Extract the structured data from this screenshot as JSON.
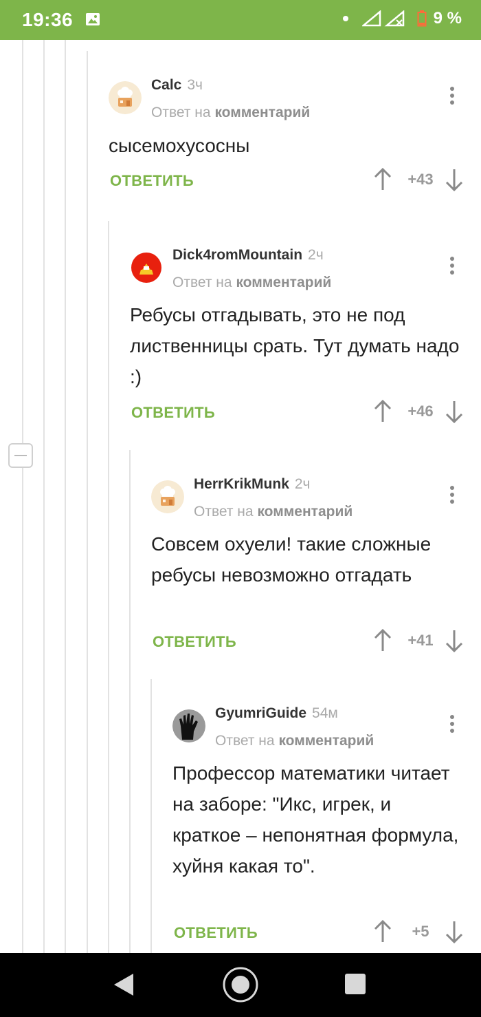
{
  "status_bar": {
    "time": "19:36",
    "battery": "9 %",
    "colors": {
      "background": "#7eb54a"
    }
  },
  "comments": [
    {
      "username": "Calc",
      "time": "3ч",
      "reply_prefix": "Ответ на",
      "reply_link": "комментарий",
      "text": "сысемохусосны",
      "reply_label": "ОТВЕТИТЬ",
      "score": "+43",
      "avatar": "chef-hat-avatar"
    },
    {
      "username": "Dick4romMountain",
      "time": "2ч",
      "reply_prefix": "Ответ на",
      "reply_link": "комментарий",
      "text": "Ребусы отгадывать, это не под лиственницы срать. Тут думать надо :)",
      "reply_label": "ОТВЕТИТЬ",
      "score": "+46",
      "avatar": "red-circle-avatar"
    },
    {
      "username": "HerrKrikMunk",
      "time": "2ч",
      "reply_prefix": "Ответ на",
      "reply_link": "комментарий",
      "text": "Совсем охуели! такие сложные ребусы невозможно отгадать",
      "reply_label": "ОТВЕТИТЬ",
      "score": "+41",
      "avatar": "chef-hat-avatar"
    },
    {
      "username": "GyumriGuide",
      "time": "54м",
      "reply_prefix": "Ответ на",
      "reply_link": "комментарий",
      "text": "Профессор математики читает на заборе: \"Икс, игрек, и краткое – непонятная формула, хуйня какая то\".",
      "reply_label": "ОТВЕТИТЬ",
      "score": "+5",
      "avatar": "black-hand-avatar"
    }
  ],
  "colors": {
    "accent": "#7eb54a",
    "muted": "#aaaaaa",
    "text": "#222222"
  }
}
